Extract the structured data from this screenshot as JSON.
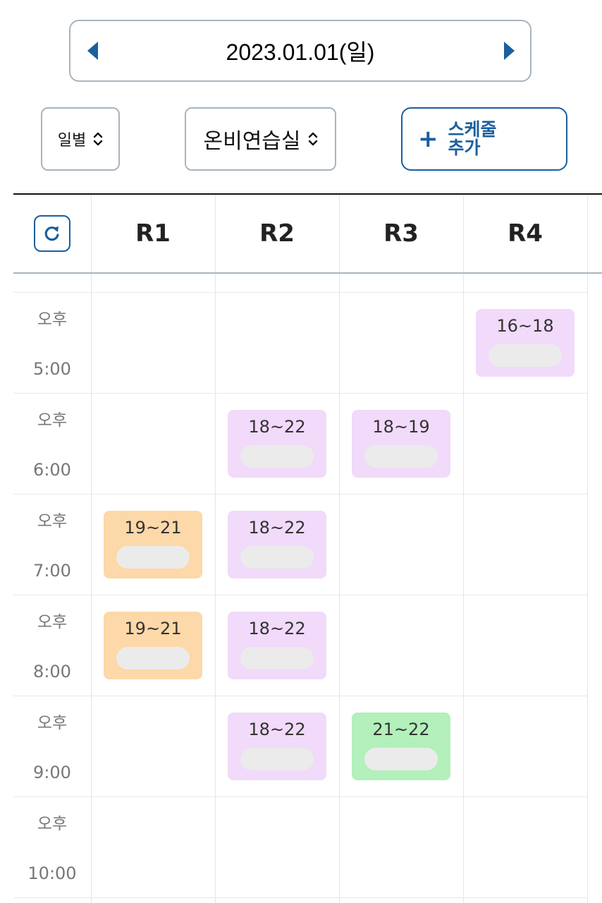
{
  "date_nav": {
    "date_text": "2023.01.01(일)"
  },
  "controls": {
    "view_select": "일별",
    "room_select": "온비연습실",
    "add_button": "스케줄 추가"
  },
  "rooms": [
    "R1",
    "R2",
    "R3",
    "R4"
  ],
  "time_slots": [
    {
      "ampm": "오후",
      "time": "5:00"
    },
    {
      "ampm": "오후",
      "time": "6:00"
    },
    {
      "ampm": "오후",
      "time": "7:00"
    },
    {
      "ampm": "오후",
      "time": "8:00"
    },
    {
      "ampm": "오후",
      "time": "9:00"
    },
    {
      "ampm": "오후",
      "time": "10:00"
    }
  ],
  "bookings": [
    {
      "room": "R4",
      "slot": "5:00",
      "range": "16~18",
      "color": "#f1dafa"
    },
    {
      "room": "R2",
      "slot": "6:00",
      "range": "18~22",
      "color": "#f1dafa"
    },
    {
      "room": "R3",
      "slot": "6:00",
      "range": "18~19",
      "color": "#f1dafa"
    },
    {
      "room": "R1",
      "slot": "7:00",
      "range": "19~21",
      "color": "#fdd8a8"
    },
    {
      "room": "R2",
      "slot": "7:00",
      "range": "18~22",
      "color": "#f1dafa"
    },
    {
      "room": "R1",
      "slot": "8:00",
      "range": "19~21",
      "color": "#fdd8a8"
    },
    {
      "room": "R2",
      "slot": "8:00",
      "range": "18~22",
      "color": "#f1dafa"
    },
    {
      "room": "R2",
      "slot": "9:00",
      "range": "18~22",
      "color": "#f1dafa"
    },
    {
      "room": "R3",
      "slot": "9:00",
      "range": "21~22",
      "color": "#b3f0bb"
    }
  ],
  "colors": {
    "accent": "#1a5f9e",
    "border": "#a9b4be"
  }
}
